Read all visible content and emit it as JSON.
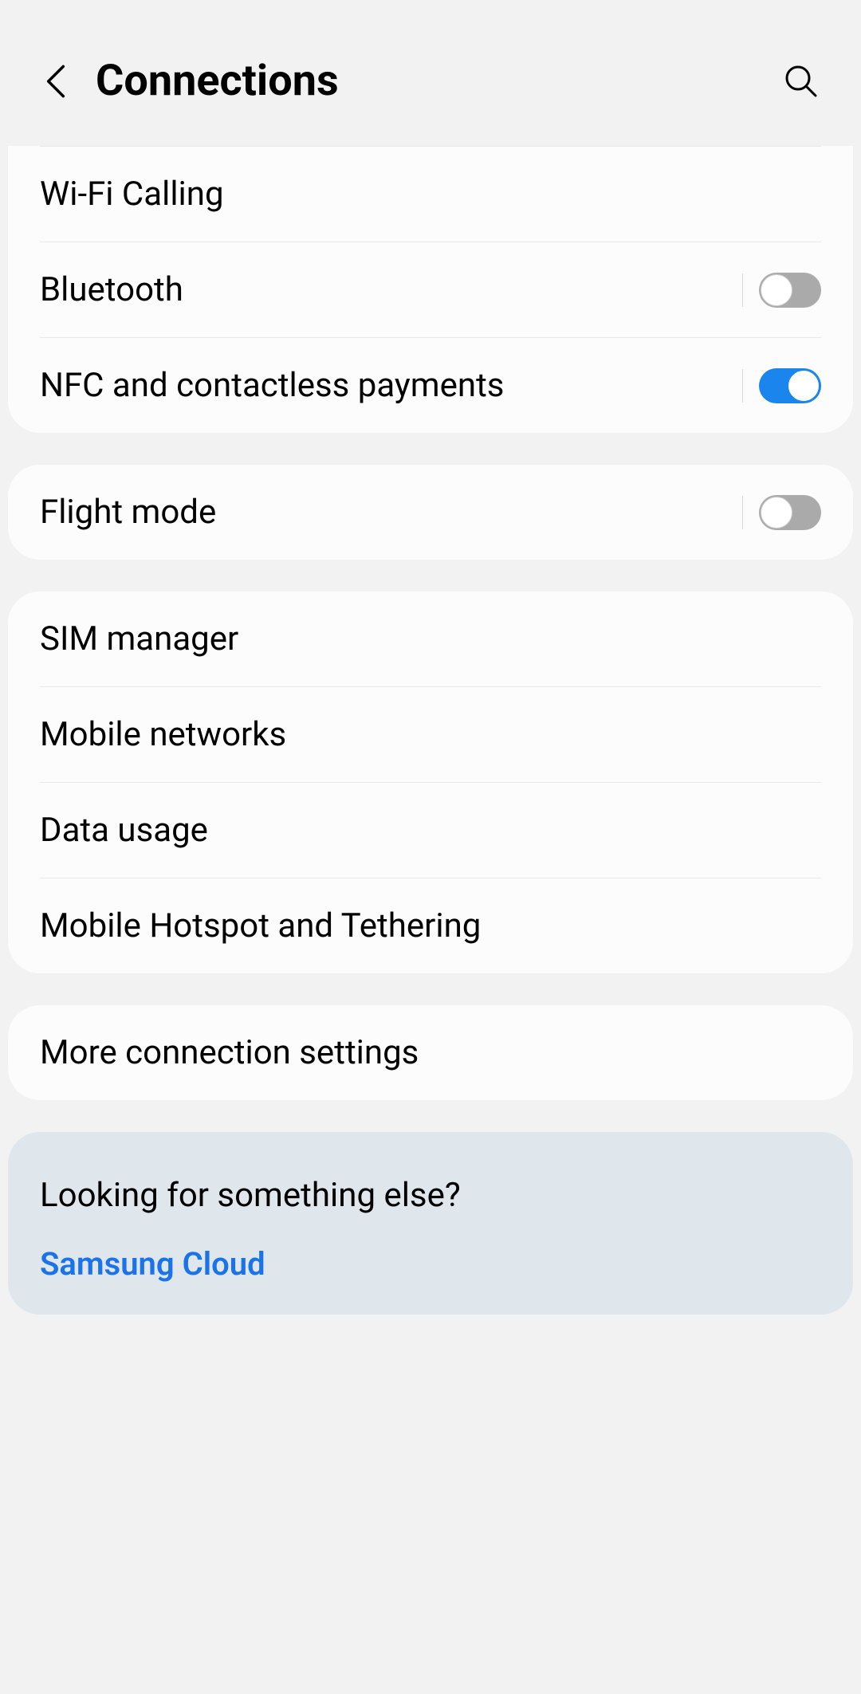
{
  "header": {
    "title": "Connections"
  },
  "groups": {
    "g1": {
      "wifi_calling": "Wi-Fi Calling",
      "bluetooth": "Bluetooth",
      "nfc": "NFC and contactless payments"
    },
    "g2": {
      "flight_mode": "Flight mode"
    },
    "g3": {
      "sim_manager": "SIM manager",
      "mobile_networks": "Mobile networks",
      "data_usage": "Data usage",
      "hotspot": "Mobile Hotspot and Tethering"
    },
    "g4": {
      "more": "More connection settings"
    }
  },
  "toggles": {
    "bluetooth": false,
    "nfc": true,
    "flight_mode": false
  },
  "suggest": {
    "title": "Looking for something else?",
    "link1": "Samsung Cloud"
  }
}
